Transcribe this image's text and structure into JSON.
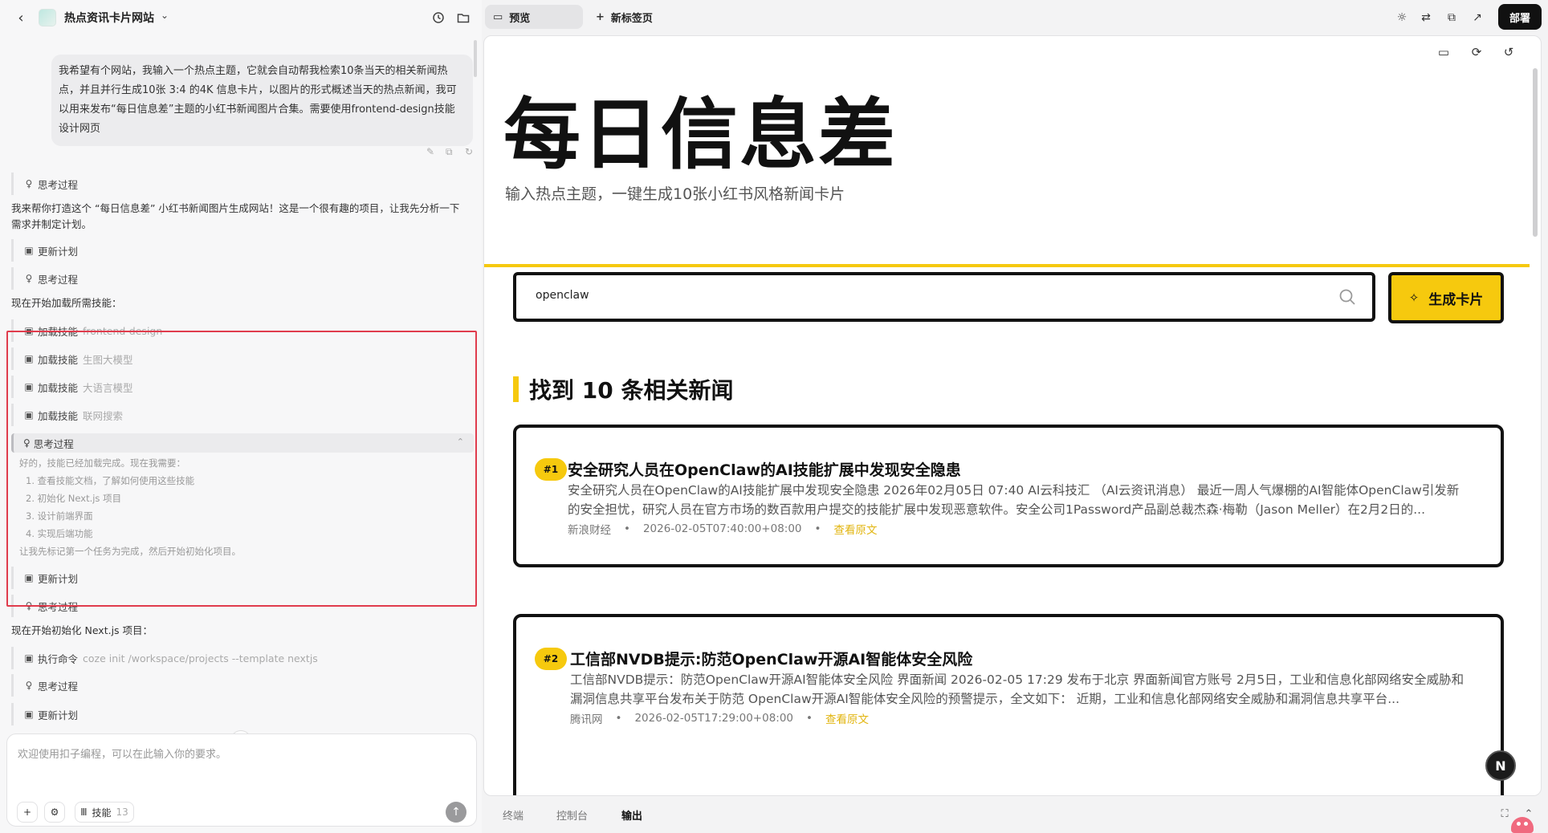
{
  "project": {
    "title": "热点资讯卡片网站"
  },
  "chat": {
    "user_message": "我希望有个网站，我输入一个热点主题，它就会自动帮我检索10条当天的相关新闻热点，并且并行生成10张 3:4 的4K 信息卡片，以图片的形式概述当天的热点新闻，我可以用来发布“每日信息差”主题的小红书新闻图片合集。需要使用frontend-design技能设计网页",
    "thinking_label": "思考过程",
    "update_plan_label": "更新计划",
    "intro_text": "我来帮你打造这个 “每日信息差” 小红书新闻图片生成网站！这是一个很有趣的项目，让我先分析一下需求并制定计划。",
    "load_skills_heading": "现在开始加载所需技能：",
    "load_skill_label": "加载技能",
    "skills": [
      "frontend-design",
      "生图大模型",
      "大语言模型",
      "联网搜索"
    ],
    "thinking_body": {
      "intro": "好的，技能已经加载完成。现在我需要：",
      "items": [
        "1.  查看技能文档，了解如何使用这些技能",
        "2.  初始化 Next.js 项目",
        "3.  设计前端界面",
        "4.  实现后端功能"
      ],
      "outro": "让我先标记第一个任务为完成，然后开始初始化项目。"
    },
    "init_heading": "现在开始初始化 Next.js 项目：",
    "exec_label": "执行命令",
    "exec_command": "coze init /workspace/projects --template nextjs"
  },
  "composer": {
    "placeholder": "欢迎使用扣子编程，可以在此输入你的要求。",
    "skill_label": "技能",
    "skill_count": "13"
  },
  "topbar": {
    "preview_tab": "预览",
    "new_tab": "新标签页",
    "deploy": "部署"
  },
  "site": {
    "title": "每日信息差",
    "subtitle": "输入热点主题，一键生成10张小红书风格新闻卡片",
    "search_value": "openclaw",
    "generate_label": "生成卡片",
    "found_text": "找到 10 条相关新闻",
    "view_source_label": "查看原文",
    "cards": [
      {
        "rank": "#1",
        "title": "安全研究人员在OpenClaw的AI技能扩展中发现安全隐患",
        "summary": "安全研究人员在OpenClaw的AI技能扩展中发现安全隐患 2026年02月05日 07:40 AI云科技汇 （AI云资讯消息） 最近一周人气爆棚的AI智能体OpenClaw引发新的安全担忧，研究人员在官方市场的数百款用户提交的技能扩展中发现恶意软件。安全公司1Password产品副总裁杰森·梅勒（Jason Meller）在2月2日的...",
        "source": "新浪财经",
        "time": "2026-02-05T07:40:00+08:00"
      },
      {
        "rank": "#2",
        "title": "工信部NVDB提示:防范OpenClaw开源AI智能体安全风险",
        "summary": "工信部NVDB提示：防范OpenClaw开源AI智能体安全风险 界面新闻 2026-02-05 17:29 发布于北京 界面新闻官方账号 2月5日，工业和信息化部网络安全威胁和漏洞信息共享平台发布关于防范 OpenClaw开源AI智能体安全风险的预警提示，全文如下： 近期，工业和信息化部网络安全威胁和漏洞信息共享平台...",
        "source": "腾讯网",
        "time": "2026-02-05T17:29:00+08:00"
      }
    ]
  },
  "bottom_tabs": {
    "terminal": "终端",
    "console": "控制台",
    "output": "输出"
  },
  "badge_letter": "N",
  "colors": {
    "accent": "#f6c90e",
    "highlight_border": "#e03c4d",
    "deploy_bg": "#111111"
  }
}
